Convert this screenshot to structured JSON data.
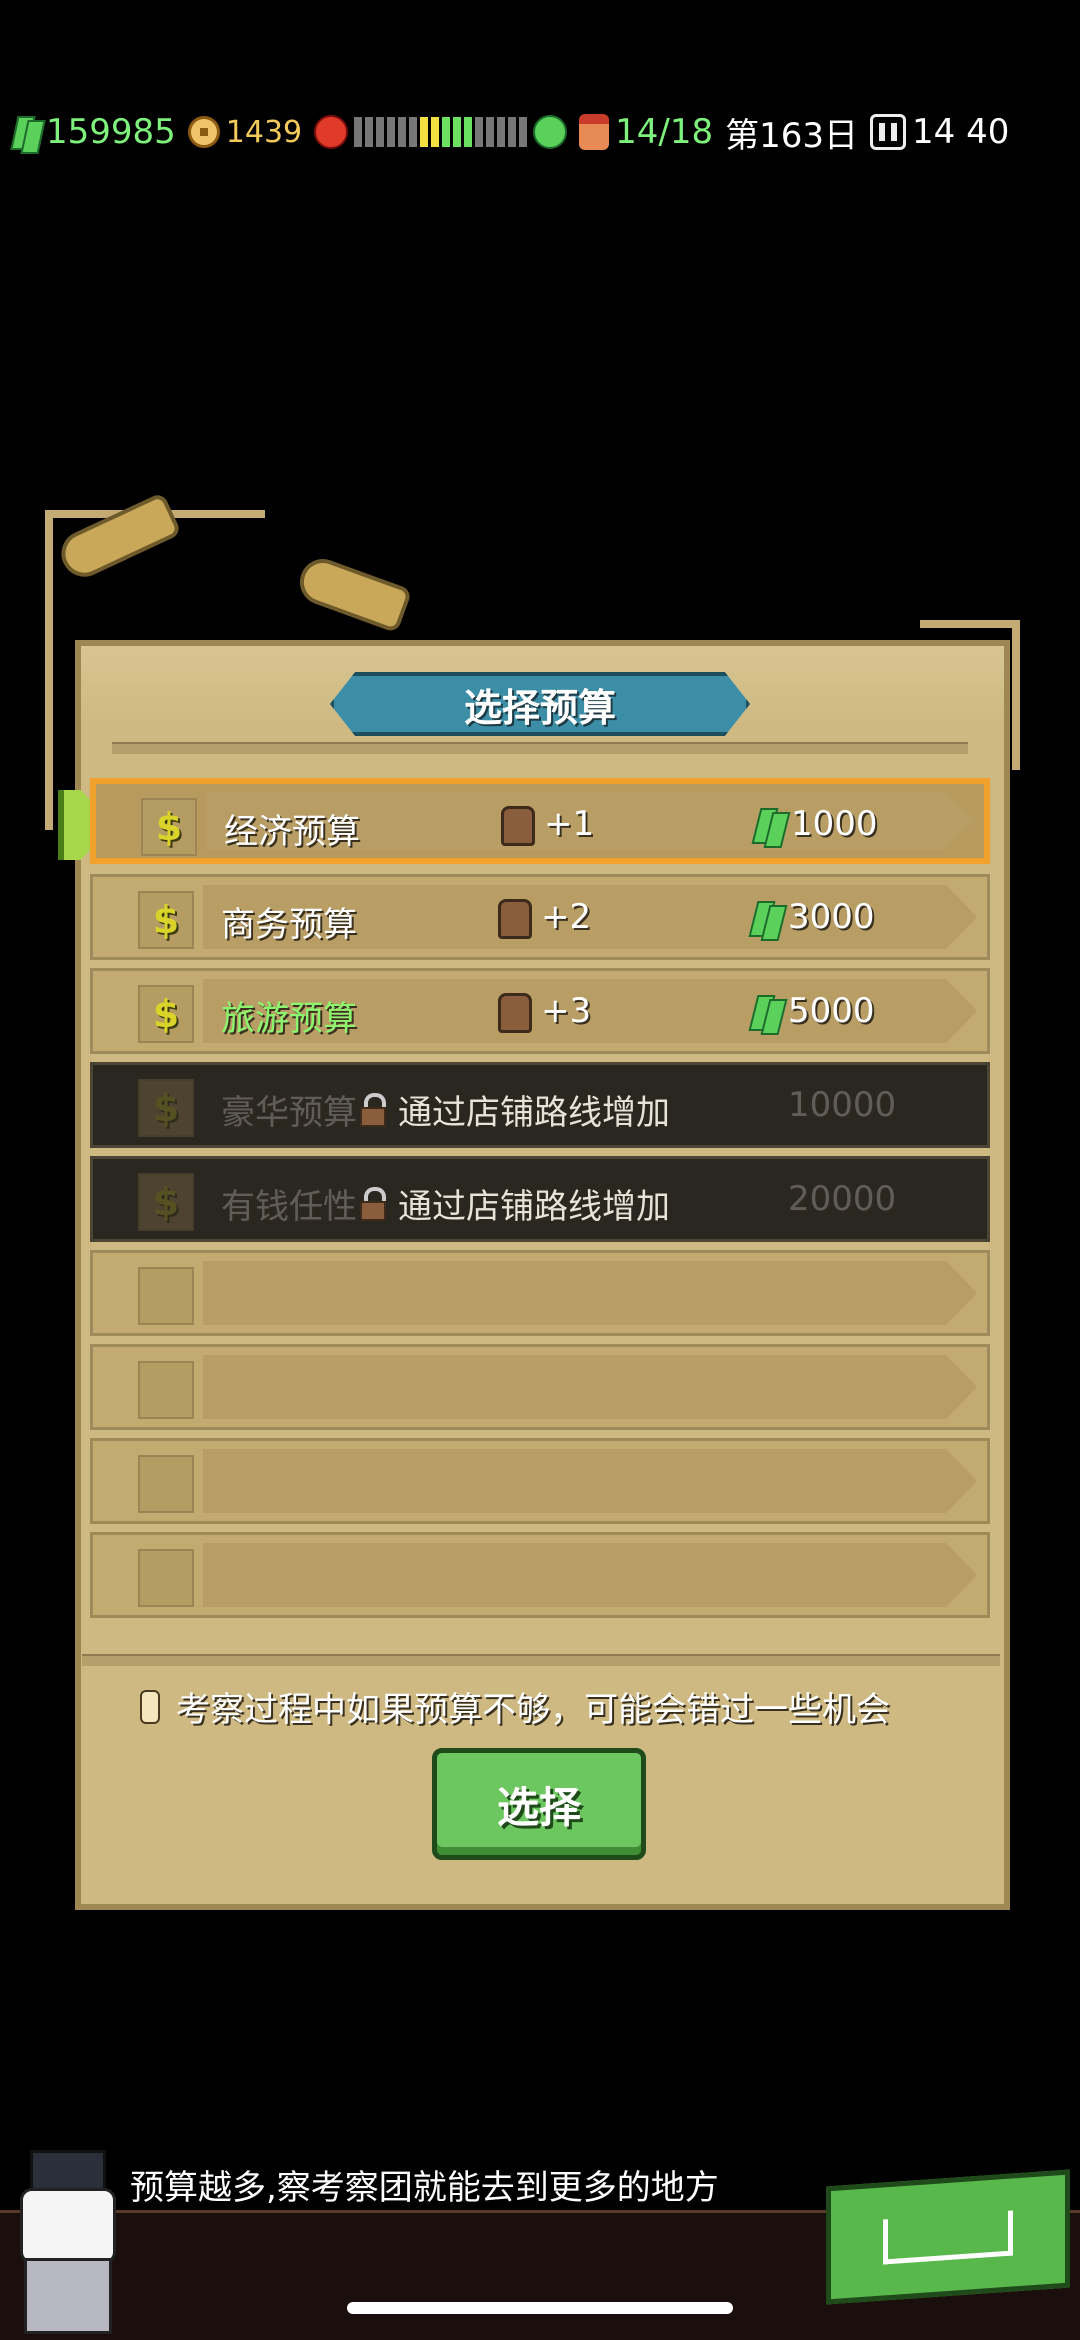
{
  "topbar": {
    "cash": "159985",
    "coins": "1439",
    "staff": "14/18",
    "day": "第163日",
    "time": "14 40"
  },
  "dialog": {
    "title": "选择预算",
    "options": [
      {
        "label": "经济预算",
        "bonus": "+1",
        "cost": "1000",
        "state": "selected",
        "icon": "dollar"
      },
      {
        "label": "商务预算",
        "bonus": "+2",
        "cost": "3000",
        "state": "normal",
        "icon": "dollar"
      },
      {
        "label": "旅游预算",
        "bonus": "+3",
        "cost": "5000",
        "state": "normal",
        "label_color": "#8bf56d",
        "icon": "dollar"
      },
      {
        "label": "豪华预算",
        "cost": "10000",
        "state": "locked",
        "lock_text": "通过店铺路线增加"
      },
      {
        "label": "有钱任性",
        "cost": "20000",
        "state": "locked",
        "lock_text": "通过店铺路线增加"
      }
    ],
    "hint": "考察过程中如果预算不够，可能会错过一些机会",
    "select_button": "选择"
  },
  "bottom": {
    "speech": "预算越多,察考察团就能去到更多的地方"
  },
  "colors": {
    "panel": "#cdb981",
    "selected_border": "#f0a22c",
    "title_banner": "#3b8ea6",
    "button_green": "#6cc760",
    "money_green": "#7ef27d"
  }
}
